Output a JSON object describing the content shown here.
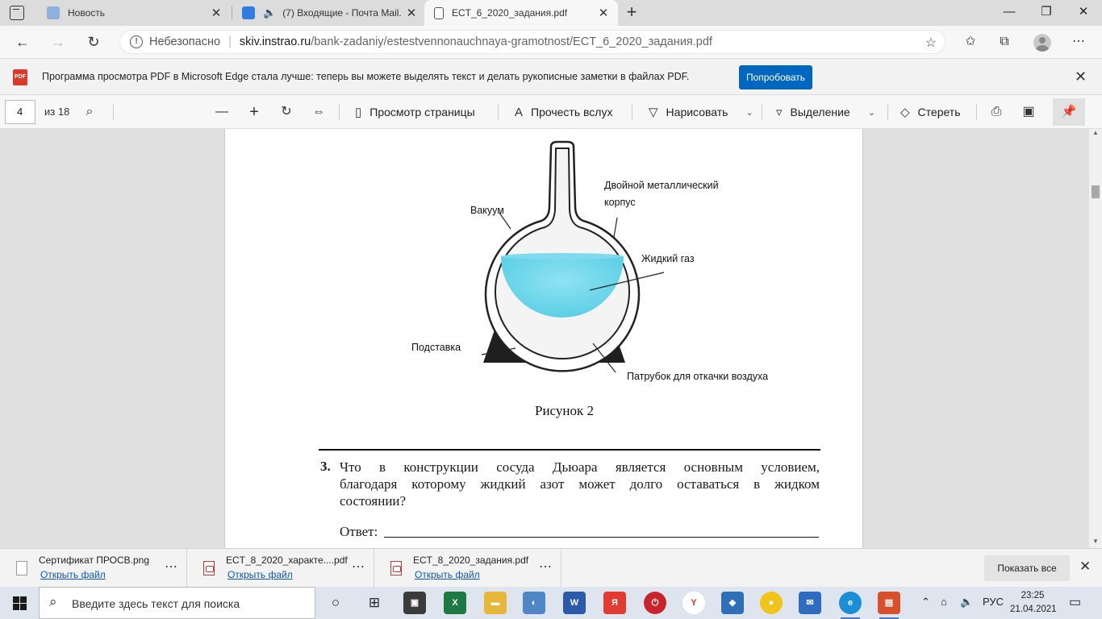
{
  "tabs": [
    {
      "title": "Новость",
      "icon": "news-icon",
      "active": false
    },
    {
      "title": "(7) Входящие - Почта Mail.",
      "icon": "mail-icon",
      "active": false
    },
    {
      "title": "ECT_6_2020_задания.pdf",
      "icon": "page-icon",
      "active": true
    }
  ],
  "address": {
    "security_label": "Небезопасно",
    "host": "skiv.instrao.ru",
    "path": "/bank-zadaniy/estestvennonauchnaya-gramotnost/ECT_6_2020_задания.pdf"
  },
  "infobar": {
    "badge": "PDF",
    "text": "Программа просмотра PDF в Microsoft Edge стала лучше: теперь вы можете выделять текст и делать рукописные заметки в файлах PDF.",
    "button_label": "Попробовать"
  },
  "pdf_toolbar": {
    "page_number": "4",
    "page_total": "из 18",
    "view_label": "Просмотр страницы",
    "read_aloud_label": "Прочесть вслух",
    "draw_label": "Нарисовать",
    "highlight_label": "Выделение",
    "erase_label": "Стереть"
  },
  "figure": {
    "labels": {
      "vacuum": "Вакуум",
      "double_body_line1": "Двойной металлический",
      "double_body_line2": "корпус",
      "liquid_gas": "Жидкий газ",
      "stand": "Подставка",
      "pipe": "Патрубок для откачки воздуха"
    },
    "caption": "Рисунок 2"
  },
  "task": {
    "number": "3.",
    "lines": [
      "Что в конструкции сосуда Дьюара является основным условием,",
      "благодаря которому жидкий азот может долго оставаться в жидком",
      "состоянии?"
    ],
    "answer_label": "Ответ:"
  },
  "downloads": {
    "items": [
      {
        "name": "Сертификат ПРОСВ.png",
        "link": "Открыть файл",
        "type": "image"
      },
      {
        "name": "ECT_8_2020_характе....pdf",
        "link": "Открыть файл",
        "type": "pdf"
      },
      {
        "name": "ECT_8_2020_задания.pdf",
        "link": "Открыть файл",
        "type": "pdf"
      }
    ],
    "show_all_label": "Показать все"
  },
  "taskbar": {
    "search_placeholder": "Введите здесь текст для поиска",
    "language": "РУС",
    "time": "23:25",
    "date": "21.04.2021"
  },
  "colors": {
    "liquid": "#5ccfe6",
    "accent": "#0067c0",
    "link": "#0b57b8"
  }
}
